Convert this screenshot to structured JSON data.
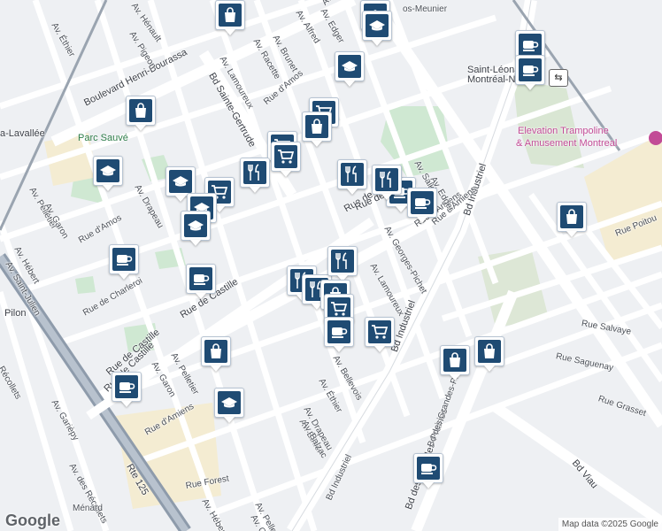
{
  "map": {
    "street_labels": [
      {
        "text": "Boulevard Henri-Bourassa",
        "class": "big"
      },
      {
        "text": "Bd Sainte-Gertrude",
        "class": "big"
      },
      {
        "text": "Rue de Castille",
        "class": "big"
      },
      {
        "text": "Rue de Castille",
        "class": "big"
      },
      {
        "text": "Rue de Castille",
        "class": "big"
      },
      {
        "text": "Rue de Castille",
        "class": "big"
      },
      {
        "text": "Bd Industriel",
        "class": "big"
      },
      {
        "text": "Bd Industriel",
        "class": "big"
      },
      {
        "text": "Bd Industriel",
        "class": ""
      },
      {
        "text": "Bd des Grandes-Prairies",
        "class": "big"
      },
      {
        "text": "Bd des Grandes-Prairies",
        "class": ""
      },
      {
        "text": "Bd Viau",
        "class": "big"
      },
      {
        "text": "Rue Forest",
        "class": ""
      },
      {
        "text": "Rue d'Amos",
        "class": ""
      },
      {
        "text": "Rue d'Amos",
        "class": ""
      },
      {
        "text": "Rue d'Amiens",
        "class": ""
      },
      {
        "text": "Rue d'Amiens",
        "class": ""
      },
      {
        "text": "Rue de Charleroi",
        "class": ""
      },
      {
        "text": "Rue Poitou",
        "class": ""
      },
      {
        "text": "Rue Salvaye",
        "class": ""
      },
      {
        "text": "Rue Saguenay",
        "class": ""
      },
      {
        "text": "Rue Grasset",
        "class": ""
      },
      {
        "text": "Av. Éthier",
        "class": ""
      },
      {
        "text": "Av. Éthier",
        "class": ""
      },
      {
        "text": "Av. Hénault",
        "class": ""
      },
      {
        "text": "Av. Pigeon",
        "class": ""
      },
      {
        "text": "Av. Alfred",
        "class": ""
      },
      {
        "text": "Av. Edger",
        "class": ""
      },
      {
        "text": "Av. Salk",
        "class": ""
      },
      {
        "text": "Av. Salk",
        "class": ""
      },
      {
        "text": "Av. Brunet",
        "class": ""
      },
      {
        "text": "Av. Racette",
        "class": ""
      },
      {
        "text": "Av. Lamoureux",
        "class": ""
      },
      {
        "text": "Av. Lamoureux",
        "class": ""
      },
      {
        "text": "Av. Georges-Pichet",
        "class": ""
      },
      {
        "text": "Av. Pelletier",
        "class": ""
      },
      {
        "text": "Av. Pelletier",
        "class": ""
      },
      {
        "text": "Av. Pelletier",
        "class": ""
      },
      {
        "text": "Av. Garon",
        "class": ""
      },
      {
        "text": "Av. Garon",
        "class": ""
      },
      {
        "text": "Av. Garon",
        "class": ""
      },
      {
        "text": "Av. Hébert",
        "class": ""
      },
      {
        "text": "Av. Hébert",
        "class": ""
      },
      {
        "text": "Av. Saint-Julien",
        "class": ""
      },
      {
        "text": "Av. Drapeau",
        "class": ""
      },
      {
        "text": "Av. Drapeau",
        "class": ""
      },
      {
        "text": "Av. Balzac",
        "class": ""
      },
      {
        "text": "Av. Bellevois",
        "class": ""
      },
      {
        "text": "Av. Éthier",
        "class": ""
      },
      {
        "text": "Av. Garièpy",
        "class": ""
      },
      {
        "text": "Av. des Récollets",
        "class": ""
      },
      {
        "text": "Récollets",
        "class": ""
      },
      {
        "text": "Ménard",
        "class": ""
      },
      {
        "text": "Rte 125",
        "class": "big"
      },
      {
        "text": "Rue d'Amiens",
        "class": ""
      },
      {
        "text": "Av. Edger",
        "class": ""
      },
      {
        "text": "Rue de",
        "class": "big"
      }
    ],
    "places": {
      "park": "Parc Sauvé",
      "lavallee": "a-Lavallée",
      "pilon": "Pilon",
      "meunier": "os-Meunier",
      "station": "Saint-Léonard–Montréal-Nord",
      "trampoline_line1": "Elevation Trampoline",
      "trampoline_line2": "& Amusement Montreal"
    },
    "markers": [
      {
        "icon": "shopping-bag-icon"
      },
      {
        "icon": "school-icon"
      },
      {
        "icon": "school-icon"
      },
      {
        "icon": "coffee-icon"
      },
      {
        "icon": "coffee-icon"
      },
      {
        "icon": "school-icon"
      },
      {
        "icon": "shopping-bag-icon"
      },
      {
        "icon": "shopping-cart-icon"
      },
      {
        "icon": "shopping-bag-icon"
      },
      {
        "icon": "shopping-cart-icon"
      },
      {
        "icon": "school-icon"
      },
      {
        "icon": "school-icon"
      },
      {
        "icon": "shopping-cart-icon"
      },
      {
        "icon": "restaurant-icon"
      },
      {
        "icon": "shopping-cart-icon"
      },
      {
        "icon": "coffee-icon"
      },
      {
        "icon": "school-icon"
      },
      {
        "icon": "school-icon"
      },
      {
        "icon": "coffee-icon"
      },
      {
        "icon": "restaurant-icon"
      },
      {
        "icon": "restaurant-icon"
      },
      {
        "icon": "coffee-icon"
      },
      {
        "icon": "coffee-icon"
      },
      {
        "icon": "restaurant-icon"
      },
      {
        "icon": "restaurant-icon"
      },
      {
        "icon": "restaurant-icon"
      },
      {
        "icon": "shopping-bag-icon"
      },
      {
        "icon": "shopping-cart-icon"
      },
      {
        "icon": "coffee-icon"
      },
      {
        "icon": "shopping-cart-icon"
      },
      {
        "icon": "shopping-bag-icon"
      },
      {
        "icon": "school-icon"
      },
      {
        "icon": "coffee-icon"
      },
      {
        "icon": "shopping-bag-icon"
      },
      {
        "icon": "shopping-bag-icon"
      },
      {
        "icon": "shopping-bag-icon"
      },
      {
        "icon": "coffee-icon"
      }
    ],
    "attribution": "Map data ©2025 Google",
    "logo": "Google",
    "station_icon": "⇆"
  },
  "colors": {
    "marker": "#1f4b73",
    "poi": "#c24b96",
    "park": "#cfe8d2",
    "water": "#aadaff",
    "rail": "#7a8796"
  }
}
